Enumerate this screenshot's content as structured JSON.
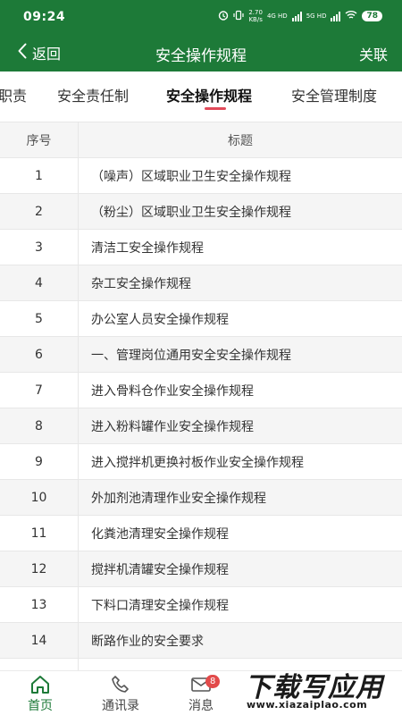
{
  "status_bar": {
    "time": "09:24",
    "net_speed": "2.70",
    "net_unit": "KB/s",
    "sig1": "4G HD",
    "sig2": "5G HD",
    "battery": "78"
  },
  "header": {
    "back_label": "返回",
    "title": "安全操作规程",
    "right_action": "关联"
  },
  "tabs": [
    {
      "label": "职责"
    },
    {
      "label": "安全责任制"
    },
    {
      "label": "安全操作规程",
      "active": true
    },
    {
      "label": "安全管理制度"
    }
  ],
  "table": {
    "headers": [
      "序号",
      "标题"
    ],
    "rows": [
      {
        "no": "1",
        "title": "（噪声）区域职业卫生安全操作规程"
      },
      {
        "no": "2",
        "title": "（粉尘）区域职业卫生安全操作规程"
      },
      {
        "no": "3",
        "title": "清洁工安全操作规程"
      },
      {
        "no": "4",
        "title": "杂工安全操作规程"
      },
      {
        "no": "5",
        "title": "办公室人员安全操作规程"
      },
      {
        "no": "6",
        "title": "一、管理岗位通用安全安全操作规程"
      },
      {
        "no": "7",
        "title": "进入骨料仓作业安全操作规程"
      },
      {
        "no": "8",
        "title": "进入粉料罐作业安全操作规程"
      },
      {
        "no": "9",
        "title": "进入搅拌机更换衬板作业安全操作规程"
      },
      {
        "no": "10",
        "title": "外加剂池清理作业安全操作规程"
      },
      {
        "no": "11",
        "title": "化粪池清理安全操作规程"
      },
      {
        "no": "12",
        "title": "搅拌机清罐安全操作规程"
      },
      {
        "no": "13",
        "title": "下料口清理安全操作规程"
      },
      {
        "no": "14",
        "title": "断路作业的安全要求"
      }
    ]
  },
  "bottom_nav": [
    {
      "label": "首页",
      "icon": "home-icon",
      "active": true
    },
    {
      "label": "通讯录",
      "icon": "phone-icon"
    },
    {
      "label": "消息",
      "icon": "mail-icon",
      "badge": "8"
    }
  ],
  "watermark": {
    "main": "下载写应用",
    "sub": "www.xiazaiplao.com"
  },
  "colors": {
    "primary": "#1d7a38",
    "accent": "#e24a5a",
    "row_alt": "#f5f5f5"
  }
}
